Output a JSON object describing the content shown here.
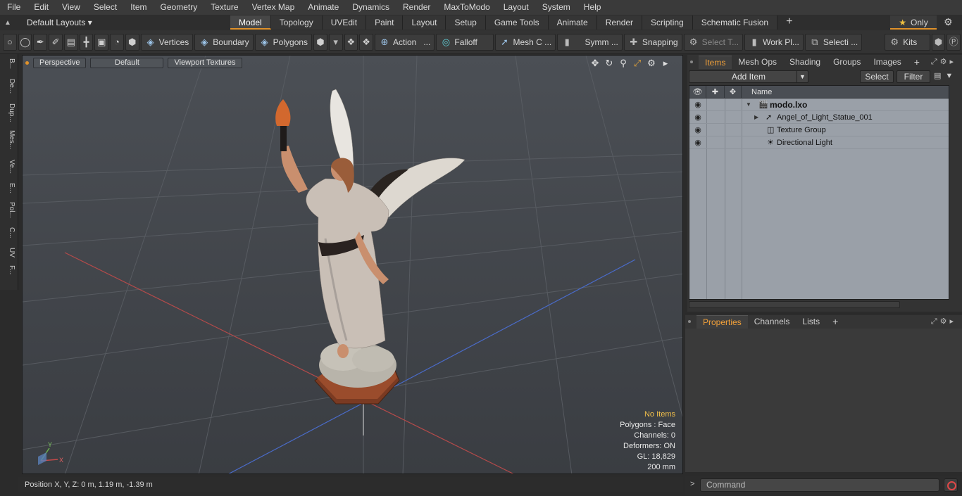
{
  "menu": [
    "File",
    "Edit",
    "View",
    "Select",
    "Item",
    "Geometry",
    "Texture",
    "Vertex Map",
    "Animate",
    "Dynamics",
    "Render",
    "MaxToModo",
    "Layout",
    "System",
    "Help"
  ],
  "layout_picker": "Default Layouts ▾",
  "tabs": [
    {
      "label": "Model",
      "active": true
    },
    {
      "label": "Topology"
    },
    {
      "label": "UVEdit"
    },
    {
      "label": "Paint"
    },
    {
      "label": "Layout"
    },
    {
      "label": "Setup"
    },
    {
      "label": "Game Tools"
    },
    {
      "label": "Animate"
    },
    {
      "label": "Render"
    },
    {
      "label": "Scripting"
    },
    {
      "label": "Schematic Fusion"
    }
  ],
  "only_label": "Only",
  "toolbar": {
    "vertices": "Vertices",
    "boundary": "Boundary",
    "polygons": "Polygons",
    "action": "Action",
    "falloff": "Falloff",
    "meshc": "Mesh C ...",
    "symm": "Symm ...",
    "snapping": "Snapping",
    "select_t": "Select T...",
    "work_pl": "Work Pl...",
    "selecti": "Selecti ...",
    "kits": "Kits"
  },
  "left_tabs": [
    "B...",
    "De...",
    "Dup...",
    "Mes...",
    "Ve...",
    "E...",
    "Pol...",
    "C...",
    "UV",
    "F..."
  ],
  "viewport": {
    "perspective": "Perspective",
    "shading": "Default",
    "textures": "Viewport Textures",
    "info": {
      "no_items": "No Items",
      "polygons": "Polygons : Face",
      "channels": "Channels: 0",
      "deformers": "Deformers: ON",
      "gl": "GL: 18,829",
      "scale": "200 mm"
    },
    "axis_x": "X",
    "axis_y": "Y"
  },
  "status": "Position X, Y, Z:   0 m, 1.19 m, -1.39 m",
  "items_tabs": [
    {
      "label": "Items",
      "active": true
    },
    {
      "label": "Mesh Ops"
    },
    {
      "label": "Shading"
    },
    {
      "label": "Groups"
    },
    {
      "label": "Images"
    }
  ],
  "items": {
    "add_item": "Add Item",
    "select": "Select",
    "filter": "Filter",
    "name_header": "Name",
    "rows": [
      {
        "label": "modo.lxo"
      },
      {
        "label": "Angel_of_Light_Statue_001"
      },
      {
        "label": "Texture Group"
      },
      {
        "label": "Directional Light"
      }
    ]
  },
  "props_tabs": [
    {
      "label": "Properties",
      "active": true
    },
    {
      "label": "Channels"
    },
    {
      "label": "Lists"
    }
  ],
  "command_placeholder": "Command",
  "colors": {
    "accent": "#e0922a",
    "info_highlight": "#f2c04a",
    "viewport_bg": "#44484e"
  }
}
